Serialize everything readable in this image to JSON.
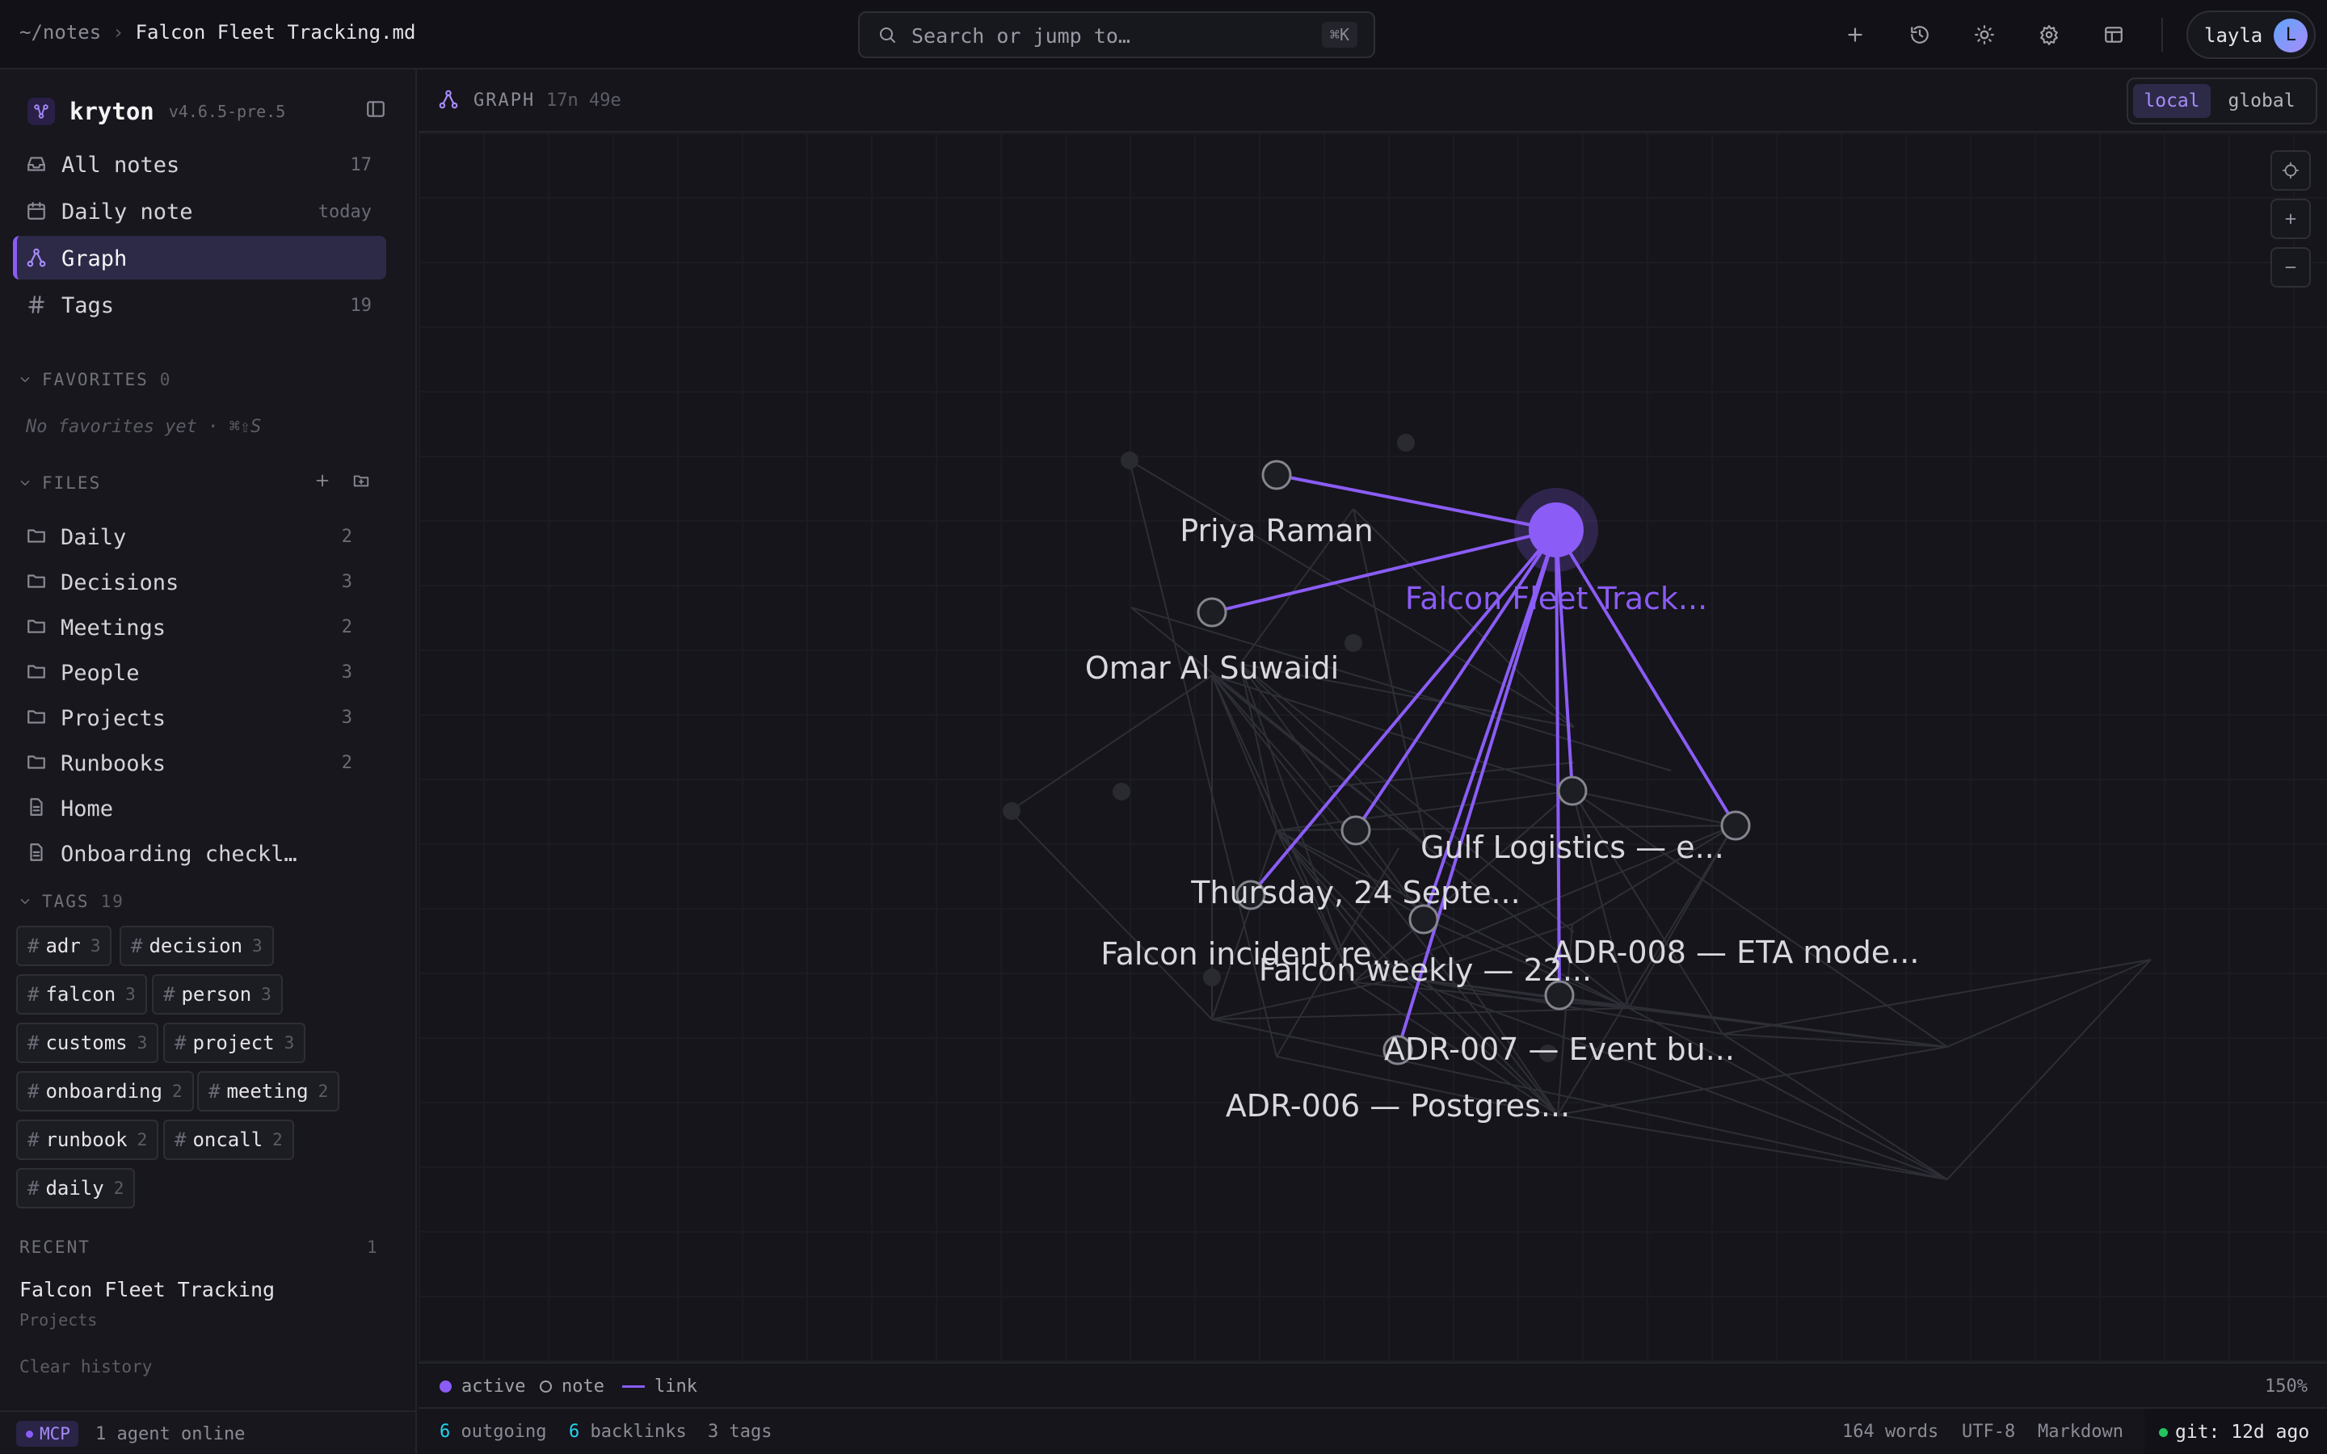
{
  "topbar": {
    "crumb_root": "~/notes",
    "crumb_sep": "›",
    "crumb_file": "Falcon Fleet Tracking.md",
    "search_placeholder": "Search or jump to…",
    "search_shortcut": "⌘K",
    "actions": [
      "plus-icon",
      "history-icon",
      "sun-icon",
      "gear-icon",
      "layout-icon"
    ],
    "user_name": "layla",
    "user_initial": "L"
  },
  "sidebar": {
    "brand_name": "kryton",
    "brand_version": "v4.6.5-pre.5",
    "nav": [
      {
        "label": "All notes",
        "count": "17",
        "icon": "inbox-icon"
      },
      {
        "label": "Daily note",
        "count": "today",
        "icon": "calendar-icon"
      },
      {
        "label": "Graph",
        "count": "",
        "icon": "graph-icon",
        "active": true
      },
      {
        "label": "Tags",
        "count": "19",
        "icon": "hash-icon"
      }
    ],
    "favorites_label": "FAVORITES",
    "favorites_count": "0",
    "favorites_empty": "No favorites yet · ⌘⇧S",
    "files_label": "FILES",
    "folders": [
      {
        "label": "Daily",
        "count": "2"
      },
      {
        "label": "Decisions",
        "count": "3"
      },
      {
        "label": "Meetings",
        "count": "2"
      },
      {
        "label": "People",
        "count": "3"
      },
      {
        "label": "Projects",
        "count": "3"
      },
      {
        "label": "Runbooks",
        "count": "2"
      }
    ],
    "files": [
      {
        "label": "Home"
      },
      {
        "label": "Onboarding checkl…"
      }
    ],
    "tags_label": "TAGS",
    "tags_count": "19",
    "tag_hash": "#",
    "tags": [
      {
        "name": "adr",
        "count": "3"
      },
      {
        "name": "decision",
        "count": "3"
      },
      {
        "name": "falcon",
        "count": "3"
      },
      {
        "name": "person",
        "count": "3"
      },
      {
        "name": "customs",
        "count": "3"
      },
      {
        "name": "project",
        "count": "3"
      },
      {
        "name": "onboarding",
        "count": "2"
      },
      {
        "name": "meeting",
        "count": "2"
      },
      {
        "name": "runbook",
        "count": "2"
      },
      {
        "name": "oncall",
        "count": "2"
      },
      {
        "name": "daily",
        "count": "2"
      }
    ],
    "recent_label": "RECENT",
    "recent_count": "1",
    "recent_title": "Falcon Fleet Tracking",
    "recent_folder": "Projects",
    "clear_history": "Clear history",
    "mcp_label": "MCP",
    "agents_online": "1 agent online"
  },
  "graph": {
    "title": "GRAPH",
    "meta": "17n 49e",
    "mode_local": "local",
    "mode_global": "global",
    "controls": [
      "target-icon",
      "zoom-in-icon",
      "zoom-out-icon"
    ],
    "active_node": "Falcon Fleet Track...",
    "nodes": [
      "Priya Raman",
      "Omar Al Suwaidi",
      "Gulf Logistics — e...",
      "Thursday, 24 Septe...",
      "Falcon incident re...",
      "Falcon weekly — 22...",
      "ADR-008 — ETA mode...",
      "ADR-007 — Event bu...",
      "ADR-006 — Postgres..."
    ],
    "legend_active": "active",
    "legend_note": "note",
    "legend_link": "link",
    "zoom": "150%",
    "accent": "#8b5cf6"
  },
  "status": {
    "outgoing_n": "6",
    "outgoing": "outgoing",
    "backlinks_n": "6",
    "backlinks": "backlinks",
    "tags": "3 tags",
    "words": "164 words",
    "encoding": "UTF-8",
    "format": "Markdown",
    "git": "git: 12d ago"
  }
}
